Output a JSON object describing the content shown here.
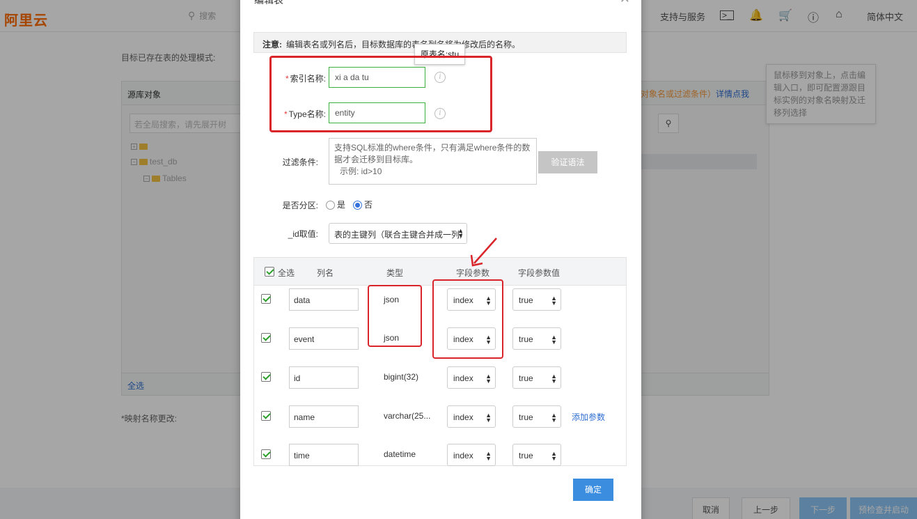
{
  "topbar": {
    "logo": "阿里云",
    "search_placeholder": "搜索",
    "support": "支持与服务",
    "language": "简体中文",
    "icons": [
      "terminal-icon",
      "bell-icon",
      "cart-icon",
      "help-icon",
      "home-icon"
    ]
  },
  "background": {
    "mode_label": "目标已存在表的处理模式:",
    "source_panel_title": "源库对象",
    "source_search_placeholder": "若全局搜索，请先展开树",
    "tree": [
      "",
      "test_db",
      "Tables"
    ],
    "select_all": "全选",
    "mapping_label": "*映射名称更改:",
    "right_hint": "对象名或过滤条件）",
    "right_link": "详情点我",
    "tip": "鼠标移到对象上，点击编辑入口，即可配置源跟目标实例的对象名映射及迁移列选择"
  },
  "dialog": {
    "title": "编辑表",
    "notice_bold": "注意:",
    "notice_text": "编辑表名或列名后，目标数据库的表名列名将为修改后的名称。",
    "tooltip": "原表名:stu",
    "index_label": "索引名称:",
    "index_value": "xi      a     da      tu",
    "type_label": "Type名称:",
    "type_value": "entity",
    "filter_label": "过滤条件:",
    "filter_placeholder_1": "支持SQL标准的where条件，只有满足where条件的数据才会迁移到目标库。",
    "filter_placeholder_2": "示例: id>10",
    "verify_button": "验证语法",
    "partition_label": "是否分区:",
    "partition_yes": "是",
    "partition_no": "否",
    "id_label": "_id取值:",
    "id_value": "表的主键列（联合主键合并成一列）",
    "columns_header": {
      "select_all": "全选",
      "name": "列名",
      "type": "类型",
      "param": "字段参数",
      "param_value": "字段参数值"
    },
    "rows": [
      {
        "name": "data",
        "type": "json",
        "param": "index",
        "value": "true"
      },
      {
        "name": "event",
        "type": "json",
        "param": "index",
        "value": "true"
      },
      {
        "name": "id",
        "type": "bigint(32)",
        "param": "index",
        "value": "true"
      },
      {
        "name": "name",
        "type": "varchar(25...",
        "param": "index",
        "value": "true"
      },
      {
        "name": "time",
        "type": "datetime",
        "param": "index",
        "value": "true"
      }
    ],
    "add_param": "添加参数",
    "ok_button": "确定"
  },
  "footer": {
    "cancel": "取消",
    "prev": "上一步",
    "next": "下一步",
    "precheck": "预检查并启动"
  },
  "colors": {
    "annotation_red": "#d9242a",
    "primary_blue": "#3b8de0",
    "valid_green": "#3cb03c",
    "brand_orange": "#ff6a00"
  }
}
